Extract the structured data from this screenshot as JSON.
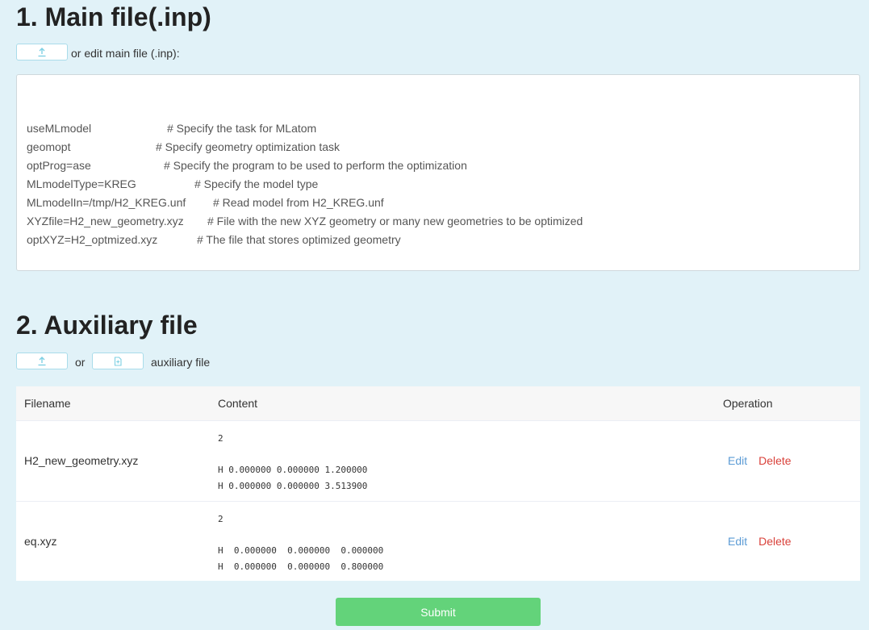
{
  "main_section": {
    "title": "1. Main file(.inp)",
    "edit_label": "or edit main file (.inp):",
    "upload_icon": "upload-icon",
    "editor_lines": [
      {
        "code": "useMLmodel",
        "comment": "# Specify the task for MLatom"
      },
      {
        "code": "geomopt",
        "comment": "# Specify geometry optimization task"
      },
      {
        "code": "optProg=ase",
        "comment": "# Specify the program to be used to perform the optimization"
      },
      {
        "code": "MLmodelType=KREG",
        "comment": "# Specify the model type"
      },
      {
        "code": "MLmodelIn=/tmp/H2_KREG.unf",
        "comment": "# Read model from H2_KREG.unf"
      },
      {
        "code": "XYZfile=H2_new_geometry.xyz",
        "comment": "# File with the new XYZ geometry or many new geometries to be optimized"
      },
      {
        "code": "optXYZ=H2_optmized.xyz",
        "comment": "# The file that stores optimized geometry"
      }
    ]
  },
  "aux_section": {
    "title": "2. Auxiliary file",
    "or_label": "or",
    "aux_label": "auxiliary file",
    "upload_icon": "upload-icon",
    "new_file_icon": "new-file-icon"
  },
  "table": {
    "headers": {
      "filename": "Filename",
      "content": "Content",
      "operation": "Operation"
    },
    "rows": [
      {
        "filename": "H2_new_geometry.xyz",
        "content": "2\n\nH 0.000000 0.000000 1.200000\nH 0.000000 0.000000 3.513900",
        "edit": "Edit",
        "delete": "Delete"
      },
      {
        "filename": "eq.xyz",
        "content": "2\n\nH  0.000000  0.000000  0.000000\nH  0.000000  0.000000  0.800000",
        "edit": "Edit",
        "delete": "Delete"
      }
    ]
  },
  "submit": {
    "label": "Submit"
  },
  "colors": {
    "background": "#e1f2f8",
    "accent": "#63d37a",
    "edit_link": "#5b9bd5",
    "delete_link": "#d9413a",
    "icon": "#7fd0e3"
  }
}
